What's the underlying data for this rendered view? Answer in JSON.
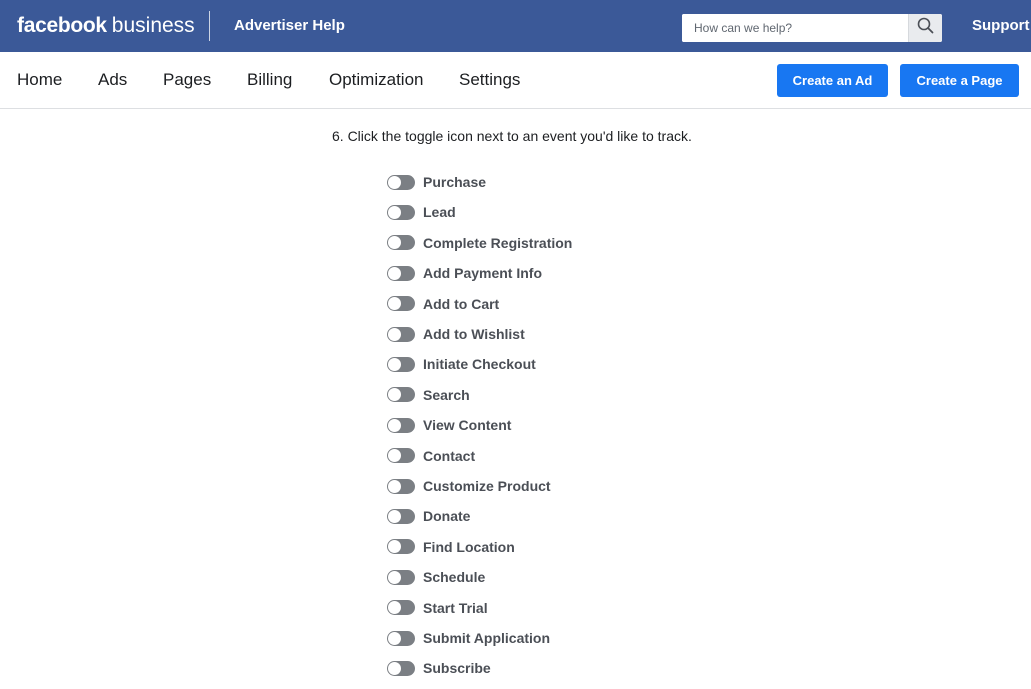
{
  "header": {
    "brand_bold": "facebook",
    "brand_light": "business",
    "section_title": "Advertiser Help",
    "search_placeholder": "How can we help?",
    "support_label": "Support",
    "bar_color": "#3b5998"
  },
  "nav": {
    "items": [
      {
        "label": "Home"
      },
      {
        "label": "Ads"
      },
      {
        "label": "Pages"
      },
      {
        "label": "Billing"
      },
      {
        "label": "Optimization"
      },
      {
        "label": "Settings"
      }
    ],
    "create_ad_label": "Create an Ad",
    "create_page_label": "Create a Page",
    "button_color": "#1877f2"
  },
  "content": {
    "instruction": "6. Click the toggle icon next to an event you'd like to track.",
    "toggle_state": "off",
    "events": [
      {
        "label": "Purchase"
      },
      {
        "label": "Lead"
      },
      {
        "label": "Complete Registration"
      },
      {
        "label": "Add Payment Info"
      },
      {
        "label": "Add to Cart"
      },
      {
        "label": "Add to Wishlist"
      },
      {
        "label": "Initiate Checkout"
      },
      {
        "label": "Search"
      },
      {
        "label": "View Content"
      },
      {
        "label": "Contact"
      },
      {
        "label": "Customize Product"
      },
      {
        "label": "Donate"
      },
      {
        "label": "Find Location"
      },
      {
        "label": "Schedule"
      },
      {
        "label": "Start Trial"
      },
      {
        "label": "Submit Application"
      },
      {
        "label": "Subscribe"
      }
    ]
  }
}
